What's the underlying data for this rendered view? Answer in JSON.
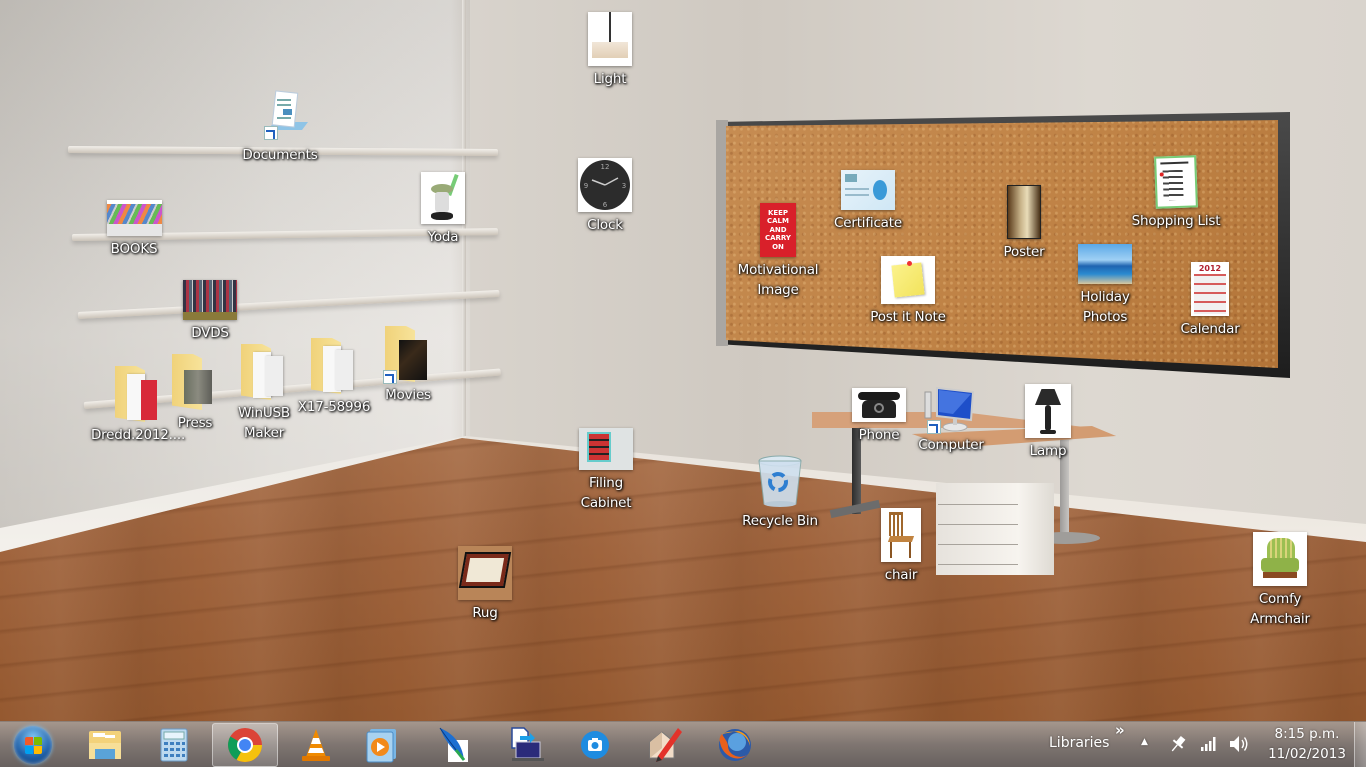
{
  "desktop": {
    "icons": {
      "documents": {
        "label": "Documents",
        "type": "shortcut"
      },
      "books": {
        "label": "BOOKS"
      },
      "yoda": {
        "label": "Yoda"
      },
      "dvds": {
        "label": "DVDS"
      },
      "dredd": {
        "label": "Dredd.2012...."
      },
      "press": {
        "label": "Press"
      },
      "winusb": {
        "label": "WinUSB\nMaker"
      },
      "x17": {
        "label": "X17-58996"
      },
      "movies": {
        "label": "Movies",
        "type": "shortcut"
      },
      "light": {
        "label": "Light"
      },
      "clock": {
        "label": "Clock"
      },
      "filing_cabinet": {
        "label": "Filing\nCabinet"
      },
      "rug": {
        "label": "Rug"
      },
      "motivational_image": {
        "label": "Motivational\nImage",
        "poster_text": "KEEP\nCALM\nAND\nCARRY\nON"
      },
      "certificate": {
        "label": "Certificate"
      },
      "poster": {
        "label": "Poster"
      },
      "shopping_list": {
        "label": "Shopping List"
      },
      "post_it_note": {
        "label": "Post it Note"
      },
      "holiday_photos": {
        "label": "Holiday\nPhotos"
      },
      "calendar": {
        "label": "Calendar",
        "year": "2012"
      },
      "phone": {
        "label": "Phone"
      },
      "computer": {
        "label": "Computer",
        "type": "shortcut"
      },
      "lamp": {
        "label": "Lamp"
      },
      "recycle_bin": {
        "label": "Recycle Bin"
      },
      "chair": {
        "label": "chair"
      },
      "comfy_armchair": {
        "label": "Comfy\nArmchair"
      }
    }
  },
  "taskbar": {
    "start_icon": "windows-orb",
    "pinned": [
      {
        "name": "windows-explorer",
        "active": false
      },
      {
        "name": "calculator",
        "active": false
      },
      {
        "name": "google-chrome",
        "active": true
      },
      {
        "name": "vlc-media-player",
        "active": false
      },
      {
        "name": "windows-media-player",
        "active": false
      },
      {
        "name": "feather-app",
        "active": false
      },
      {
        "name": "remote-desktop",
        "active": false
      },
      {
        "name": "snipping-camera",
        "active": false
      },
      {
        "name": "sketchup",
        "active": false
      },
      {
        "name": "firefox",
        "active": false
      }
    ],
    "toolbar_label": "Libraries",
    "toolbar_chevron": "»",
    "tray": {
      "show_hidden": "▲",
      "time": "8:15 p.m.",
      "date": "11/02/2013"
    }
  }
}
